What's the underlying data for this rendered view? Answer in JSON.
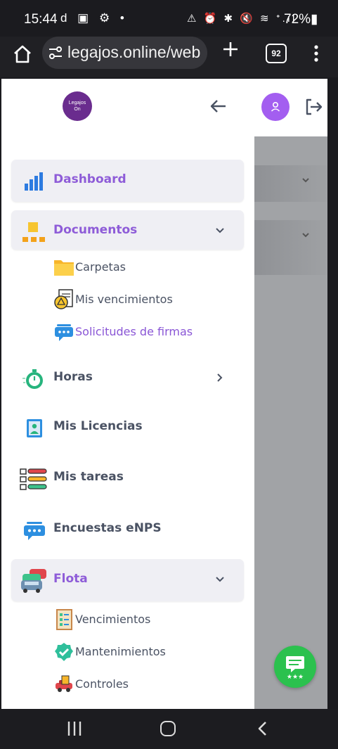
{
  "status_bar": {
    "time": "15:44",
    "left_icons": "d ▣ ⚙ •",
    "right_icons": "⚠ ⏰ ✱ 🔇 ≋ ᐩ.ıl",
    "battery": "72%"
  },
  "browser": {
    "url": "legajos.online/web",
    "tab_count": "92"
  },
  "app": {
    "logo_line1": "Legajos",
    "logo_line2": "On"
  },
  "sidebar": {
    "items": [
      {
        "label": "Dashboard"
      },
      {
        "label": "Documentos"
      },
      {
        "label": "Horas"
      },
      {
        "label": "Mis Licencias"
      },
      {
        "label": "Mis tareas"
      },
      {
        "label": "Encuestas eNPS"
      },
      {
        "label": "Flota"
      }
    ],
    "documentos_sub": [
      {
        "label": "Carpetas"
      },
      {
        "label": "Mis vencimientos"
      },
      {
        "label": "Solicitudes de firmas"
      }
    ],
    "flota_sub": [
      {
        "label": "Vencimientos"
      },
      {
        "label": "Mantenimientos"
      },
      {
        "label": "Controles"
      }
    ]
  },
  "colors": {
    "accent_purple": "#8e5cd8",
    "text_dark": "#4a5263",
    "avatar": "#a35ef0",
    "fab_green": "#2bc14e"
  }
}
